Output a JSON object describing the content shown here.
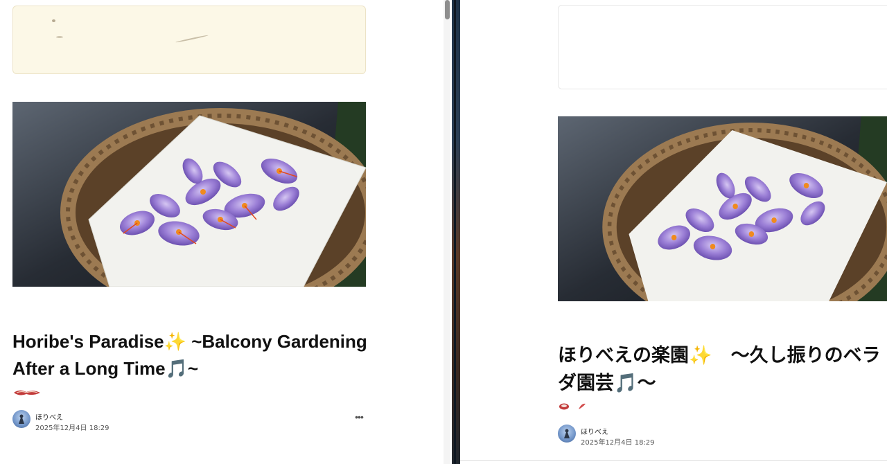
{
  "left_post": {
    "title": "Horibe's Paradise✨ ~Balcony Gardening After a Long Time🎵~",
    "author": "ほりべえ",
    "date": "2025年12月4日 18:29",
    "more_label": "•••",
    "image_icon": "saffron-crocus-basket-photo"
  },
  "right_post": {
    "title_line1": "ほりべえの楽園✨　～久し振りのベラ",
    "title_line2": "ダ園芸🎵～",
    "author": "ほりべえ",
    "date": "2025年12月4日 18:29",
    "image_icon": "saffron-crocus-basket-photo"
  },
  "colors": {
    "banner_left_bg": "#fcf8e7",
    "flower_purple": "#9b7fd6",
    "basket_brown": "#8a6a45"
  }
}
